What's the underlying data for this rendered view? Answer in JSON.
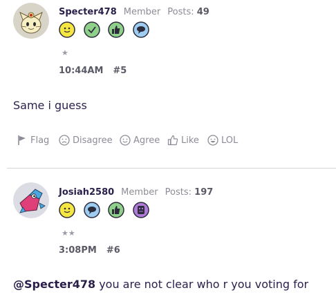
{
  "posts": [
    {
      "username": "Specter478",
      "role": "Member",
      "posts_label": "Posts:",
      "posts_count": "49",
      "badges": [
        "smile-icon",
        "check-icon",
        "thumbs-up-icon",
        "speech-bubble-icon"
      ],
      "stars": "★",
      "time": "10:44AM",
      "post_number": "#5",
      "message": "Same i guess"
    },
    {
      "username": "Josiah2580",
      "role": "Member",
      "posts_label": "Posts:",
      "posts_count": "197",
      "badges": [
        "smile-icon",
        "speech-bubble-icon",
        "thumbs-up-icon",
        "ghost-icon"
      ],
      "stars": "★★",
      "time": "3:08PM",
      "post_number": "#6",
      "mention": "@Specter478",
      "message": " you are not clear who r you voting for"
    }
  ],
  "actions": {
    "flag": "Flag",
    "disagree": "Disagree",
    "agree": "Agree",
    "like": "Like",
    "lol": "LOL"
  },
  "colors": {
    "username": "#2a1f4a",
    "muted": "#8c8c96",
    "divider": "#d4d4da"
  }
}
